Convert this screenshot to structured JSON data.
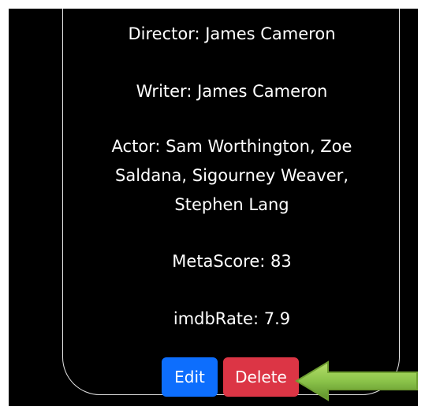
{
  "movie": {
    "director": "Director: James Cameron",
    "writer": "Writer: James Cameron",
    "actor": "Actor: Sam Worthington, Zoe Saldana, Sigourney Weaver, Stephen Lang",
    "metascore": "MetaScore: 83",
    "imdb_rate": "imdbRate: 7.9"
  },
  "actions": {
    "edit_label": "Edit",
    "delete_label": "Delete"
  },
  "annotation": {
    "icon": "arrow-left-icon",
    "color": "#8bc34a"
  },
  "colors": {
    "edit_button": "#0d6efd",
    "delete_button": "#dc3545",
    "background": "#000000",
    "text": "#ffffff"
  }
}
